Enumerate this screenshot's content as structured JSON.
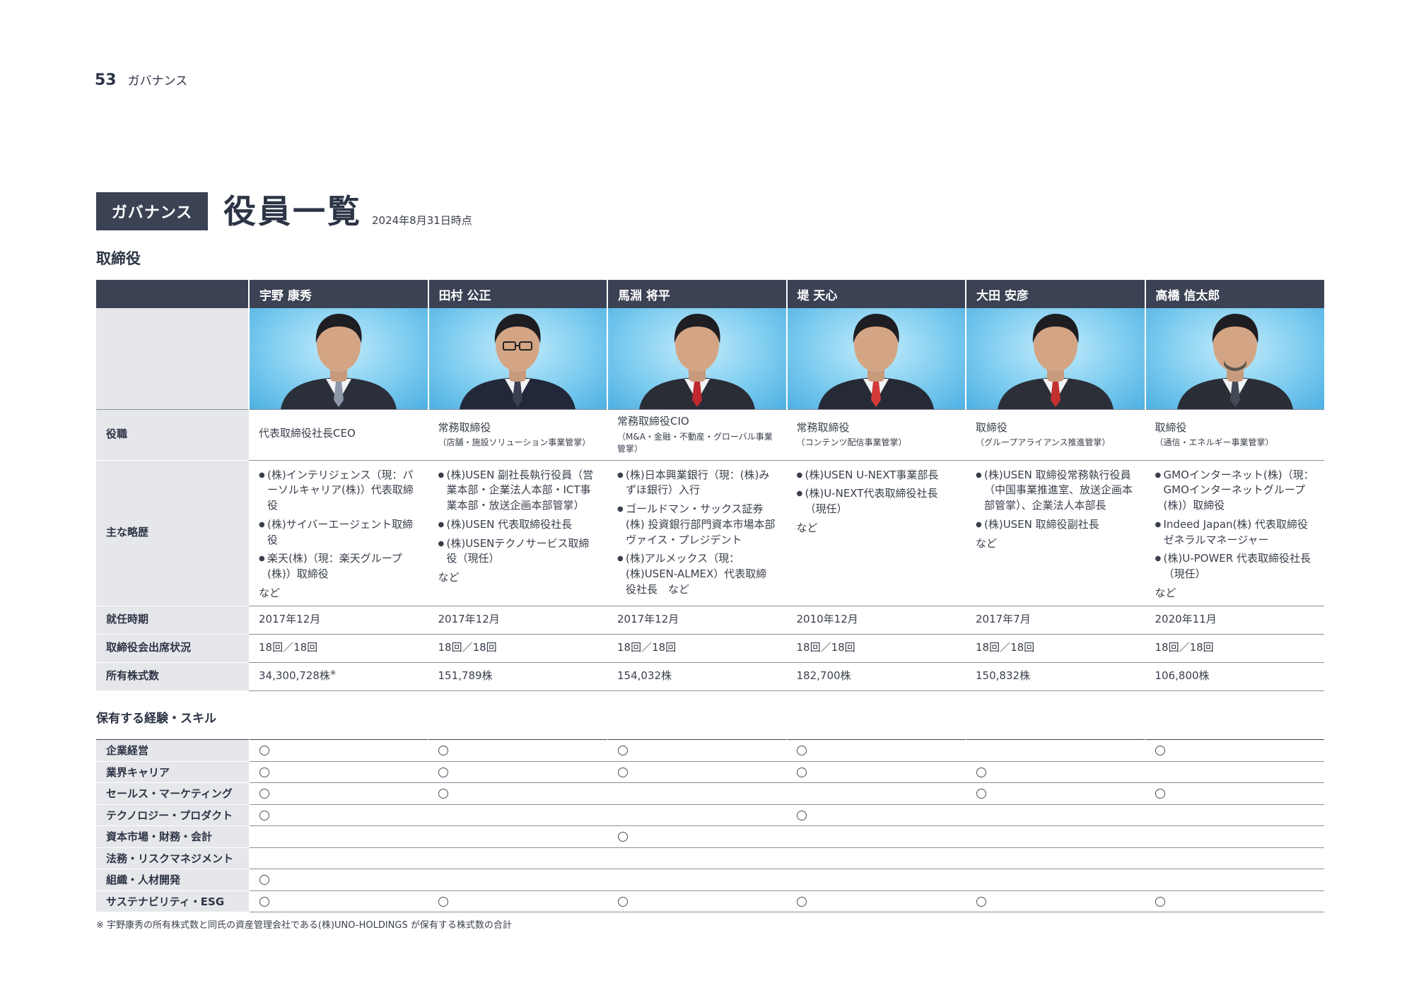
{
  "header": {
    "page_number": "53",
    "section": "ガバナンス"
  },
  "title": {
    "badge": "ガバナンス",
    "main": "役員一覧",
    "as_of": "2024年8月31日時点"
  },
  "directors_heading": "取締役",
  "row_labels": {
    "position": "役職",
    "career": "主な略歴",
    "appointed": "就任時期",
    "attendance": "取締役会出席状況",
    "shares": "所有株式数"
  },
  "directors": [
    {
      "name": "宇野 康秀",
      "role": "代表取締役社長CEO",
      "role_sub": "",
      "career": [
        "(株)インテリジェンス（現：パーソルキャリア(株)）代表取締役",
        "(株)サイバーエージェント取締役",
        "楽天(株)（現：楽天グループ(株)）取締役"
      ],
      "career_note": "など",
      "appointed": "2017年12月",
      "attendance": "18回／18回",
      "shares": "34,300,728株",
      "shares_mark": "※"
    },
    {
      "name": "田村 公正",
      "role": "常務取締役",
      "role_sub": "（店舗・施設ソリューション事業管掌）",
      "career": [
        "(株)USEN 副社長執行役員（営業本部・企業法人本部・ICT事業本部・放送企画本部管掌）",
        "(株)USEN 代表取締役社長",
        "(株)USENテクノサービス取締役（現任）"
      ],
      "career_note": "など",
      "appointed": "2017年12月",
      "attendance": "18回／18回",
      "shares": "151,789株",
      "shares_mark": ""
    },
    {
      "name": "馬淵 将平",
      "role": "常務取締役CIO",
      "role_sub": "（M&A・金融・不動産・グローバル事業管掌）",
      "career": [
        "(株)日本興業銀行（現：(株)みずほ銀行）入行",
        "ゴールドマン・サックス証券(株) 投資銀行部門資本市場本部 ヴァイス・プレジデント",
        "(株)アルメックス（現：(株)USEN-ALMEX）代表取締役社長　など"
      ],
      "career_note": "",
      "appointed": "2017年12月",
      "attendance": "18回／18回",
      "shares": "154,032株",
      "shares_mark": ""
    },
    {
      "name": "堤 天心",
      "role": "常務取締役",
      "role_sub": "（コンテンツ配信事業管掌）",
      "career": [
        "(株)USEN U-NEXT事業部長",
        "(株)U-NEXT代表取締役社長（現任）"
      ],
      "career_note": "など",
      "appointed": "2010年12月",
      "attendance": "18回／18回",
      "shares": "182,700株",
      "shares_mark": ""
    },
    {
      "name": "大田 安彦",
      "role": "取締役",
      "role_sub": "（グループアライアンス推進管掌）",
      "career": [
        "(株)USEN 取締役常務執行役員（中国事業推進室、放送企画本部管掌）、企業法人本部長",
        "(株)USEN 取締役副社長"
      ],
      "career_note": "など",
      "appointed": "2017年7月",
      "attendance": "18回／18回",
      "shares": "150,832株",
      "shares_mark": ""
    },
    {
      "name": "高橋 信太郎",
      "role": "取締役",
      "role_sub": "（通信・エネルギー事業管掌）",
      "career": [
        "GMOインターネット(株)（現：GMOインターネットグループ(株)）取締役",
        "Indeed Japan(株) 代表取締役 ゼネラルマネージャー",
        "(株)U-POWER 代表取締役社長（現任）"
      ],
      "career_note": "など",
      "appointed": "2020年11月",
      "attendance": "18回／18回",
      "shares": "106,800株",
      "shares_mark": ""
    }
  ],
  "skills_heading": "保有する経験・スキル",
  "skills": [
    {
      "label": "企業経営",
      "checks": [
        true,
        true,
        true,
        true,
        false,
        true
      ]
    },
    {
      "label": "業界キャリア",
      "checks": [
        true,
        true,
        true,
        true,
        true,
        false
      ]
    },
    {
      "label": "セールス・マーケティング",
      "checks": [
        true,
        true,
        false,
        false,
        true,
        true
      ]
    },
    {
      "label": "テクノロジー・プロダクト",
      "checks": [
        true,
        false,
        false,
        true,
        false,
        false
      ]
    },
    {
      "label": "資本市場・財務・会計",
      "checks": [
        false,
        false,
        true,
        false,
        false,
        false
      ]
    },
    {
      "label": "法務・リスクマネジメント",
      "checks": [
        false,
        false,
        false,
        false,
        false,
        false
      ]
    },
    {
      "label": "組織・人材開発",
      "checks": [
        true,
        false,
        false,
        false,
        false,
        false
      ]
    },
    {
      "label": "サステナビリティ・ESG",
      "checks": [
        true,
        true,
        true,
        true,
        true,
        true
      ]
    }
  ],
  "footnote": "※ 宇野康秀の所有株式数と同氏の資産管理会社である(株)UNO-HOLDINGS が保有する株式数の合計"
}
